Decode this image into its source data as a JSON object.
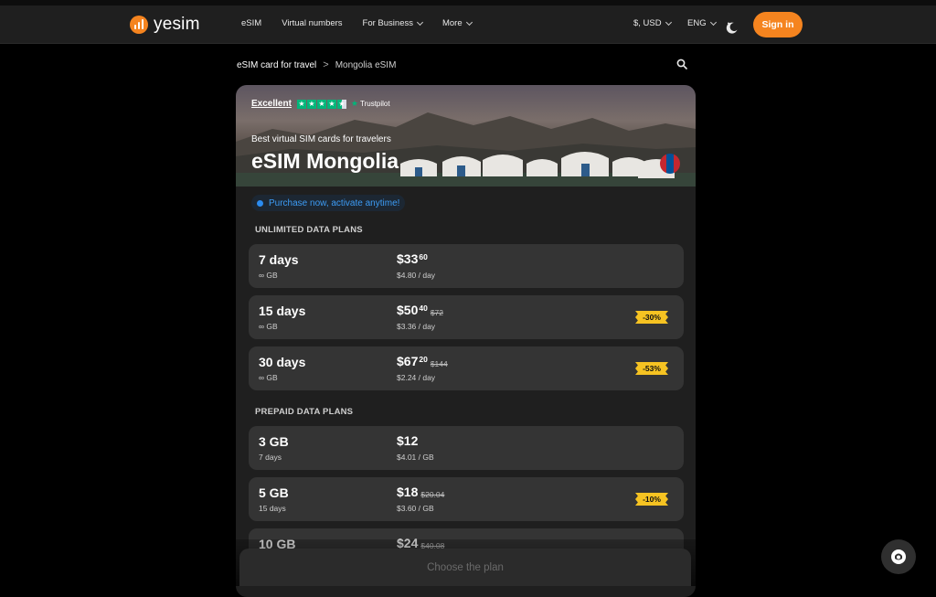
{
  "header": {
    "logo_text": "yesim",
    "nav": [
      {
        "label": "eSIM",
        "has_chevron": false
      },
      {
        "label": "Virtual numbers",
        "has_chevron": false
      },
      {
        "label": "For Business",
        "has_chevron": true
      },
      {
        "label": "More",
        "has_chevron": true
      }
    ],
    "currency": "$, USD",
    "language": "ENG",
    "theme_icon": "moon-icon",
    "signin_label": "Sign in",
    "accent_color": "#f5841f"
  },
  "breadcrumb": {
    "items": [
      "eSIM card for travel",
      "Mongolia eSIM"
    ],
    "separator": ">"
  },
  "hero": {
    "rating_label": "Excellent",
    "rating_provider": "Trustpilot",
    "subtitle": "Best virtual SIM cards for travelers",
    "title": "eSIM Mongolia",
    "flag_icon": "mongolia-flag-icon",
    "flag_colors": [
      "#c4272f",
      "#015197",
      "#c4272f"
    ]
  },
  "purchase_badge": "Purchase now, activate anytime!",
  "sections": {
    "unlimited_title": "UNLIMITED DATA PLANS",
    "prepaid_title": "PREPAID DATA PLANS"
  },
  "unlimited_plans": [
    {
      "name": "7 days",
      "sub": "∞ GB",
      "price": "$33",
      "cents": "60",
      "old": "",
      "per": "$4.80 / day",
      "badge": ""
    },
    {
      "name": "15 days",
      "sub": "∞ GB",
      "price": "$50",
      "cents": "40",
      "old": "$72",
      "per": "$3.36 / day",
      "badge": "-30%"
    },
    {
      "name": "30 days",
      "sub": "∞ GB",
      "price": "$67",
      "cents": "20",
      "old": "$144",
      "per": "$2.24 / day",
      "badge": "-53%"
    }
  ],
  "prepaid_plans": [
    {
      "name": "3 GB",
      "sub": "7 days",
      "price": "$12",
      "cents": "",
      "old": "",
      "per": "$4.01 / GB",
      "badge": ""
    },
    {
      "name": "5 GB",
      "sub": "15 days",
      "price": "$18",
      "cents": "",
      "old": "$20.04",
      "per": "$3.60 / GB",
      "badge": "-10%"
    },
    {
      "name": "10 GB",
      "sub": "",
      "price": "$24",
      "cents": "",
      "old": "$40.08",
      "per": "",
      "badge": ""
    }
  ],
  "cta_label": "Choose the plan",
  "chat_icon": "chat-support-icon"
}
